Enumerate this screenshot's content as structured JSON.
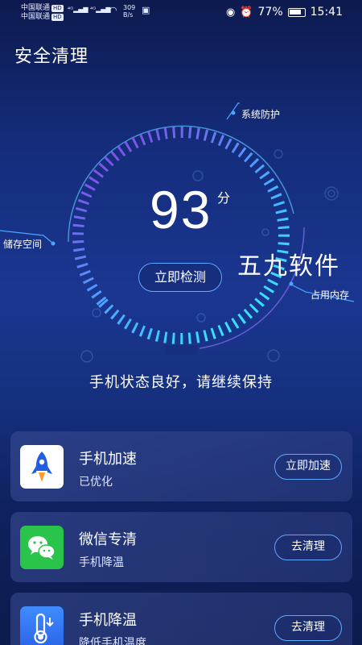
{
  "statusbar": {
    "carrier1": "中国联通",
    "carrier2": "中国联通",
    "hd": "HD",
    "net_speed": "309",
    "net_unit": "B/s",
    "battery": "77%",
    "time": "15:41"
  },
  "header": {
    "title": "安全清理"
  },
  "gauge": {
    "score": "93",
    "unit": "分",
    "detect_button": "立即检测",
    "label_system": "系统防护",
    "label_storage": "储存空间",
    "label_memory": "占用内存",
    "status_text": "手机状态良好，请继续保持"
  },
  "watermark": "五九软件",
  "cards": [
    {
      "name": "手机加速",
      "desc": "已优化",
      "action": "立即加速",
      "icon": "rocket-icon"
    },
    {
      "name": "微信专清",
      "desc": "手机降温",
      "action": "去清理",
      "icon": "wechat-icon"
    },
    {
      "name": "手机降温",
      "desc": "降低手机温度",
      "action": "去清理",
      "icon": "thermometer-icon"
    }
  ]
}
